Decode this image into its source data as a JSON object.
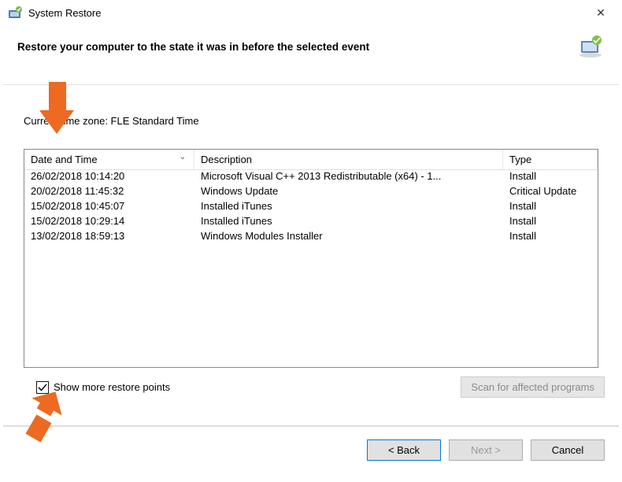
{
  "window": {
    "title": "System Restore",
    "close_label": "✕"
  },
  "heading": "Restore your computer to the state it was in before the selected event",
  "timezone_line": "Current time zone: FLE Standard Time",
  "columns": {
    "date": "Date and Time",
    "desc": "Description",
    "type": "Type"
  },
  "rows": [
    {
      "date": "26/02/2018 10:14:20",
      "desc": "Microsoft Visual C++ 2013 Redistributable (x64) - 1...",
      "type": "Install"
    },
    {
      "date": "20/02/2018 11:45:32",
      "desc": "Windows Update",
      "type": "Critical Update"
    },
    {
      "date": "15/02/2018 10:45:07",
      "desc": "Installed iTunes",
      "type": "Install"
    },
    {
      "date": "15/02/2018 10:29:14",
      "desc": "Installed iTunes",
      "type": "Install"
    },
    {
      "date": "13/02/2018 18:59:13",
      "desc": "Windows Modules Installer",
      "type": "Install"
    }
  ],
  "checkbox_label": "Show more restore points",
  "scan_button": "Scan for affected programs",
  "buttons": {
    "back": "< Back",
    "next": "Next >",
    "cancel": "Cancel"
  }
}
